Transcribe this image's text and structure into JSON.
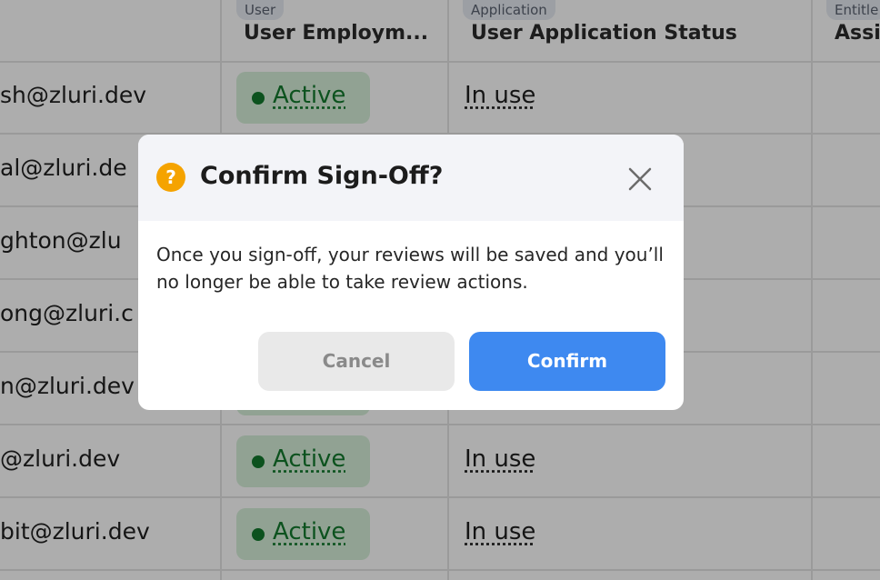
{
  "table": {
    "columns": [
      {
        "chip": "",
        "title": ""
      },
      {
        "chip": "User",
        "title": "User Employm..."
      },
      {
        "chip": "Application",
        "title": "User Application Status"
      },
      {
        "chip": "Entitle",
        "title": "Assi"
      }
    ],
    "rows": [
      {
        "email": "sh@zluri.dev",
        "status": "Active",
        "usage": "In use"
      },
      {
        "email": "al@zluri.de",
        "status": "",
        "usage": ""
      },
      {
        "email": "ghton@zlu",
        "status": "",
        "usage": ""
      },
      {
        "email": "ong@zluri.c",
        "status": "",
        "usage": ""
      },
      {
        "email": "n@zluri.dev",
        "status": "",
        "usage": ""
      },
      {
        "email": "@zluri.dev",
        "status": "Active",
        "usage": "In use"
      },
      {
        "email": "bit@zluri.dev",
        "status": "Active",
        "usage": "In use"
      }
    ]
  },
  "dialog": {
    "title": "Confirm Sign-Off?",
    "icon": "question-icon",
    "message": "Once you sign-off, your reviews will be saved and you’ll no longer be able to take review actions.",
    "cancel_label": "Cancel",
    "confirm_label": "Confirm",
    "close_icon": "close-icon"
  },
  "colors": {
    "active_status": "#137a2d",
    "active_bg": "#d6efd9",
    "confirm_button": "#3e89f0",
    "warning_icon": "#f5a300"
  }
}
